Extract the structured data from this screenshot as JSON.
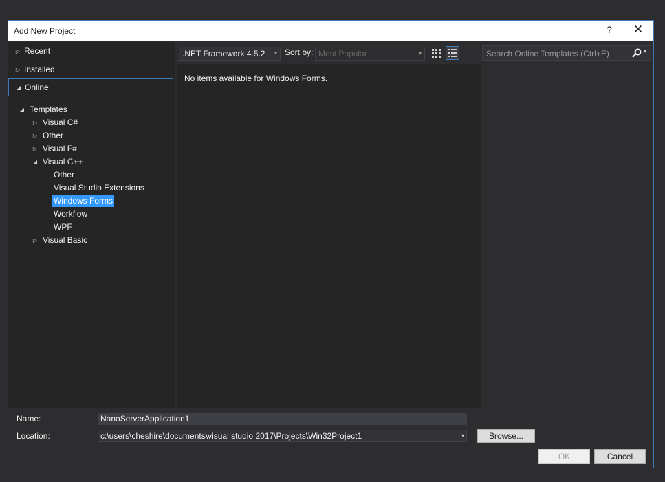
{
  "dialog": {
    "title": "Add New Project",
    "help_label": "?",
    "close_label": "✕"
  },
  "nav": {
    "sections": [
      {
        "label": "Recent",
        "arrow": "▷"
      },
      {
        "label": "Installed",
        "arrow": "▷"
      },
      {
        "label": "Online",
        "arrow": "◢"
      }
    ],
    "tree": [
      {
        "label": "Templates",
        "arrow": "◢"
      },
      {
        "label": "Visual C#",
        "arrow": "▷"
      },
      {
        "label": "Other",
        "arrow": "▷"
      },
      {
        "label": "Visual F#",
        "arrow": "▷"
      },
      {
        "label": "Visual C++",
        "arrow": "◢"
      },
      {
        "label": "Other",
        "arrow": ""
      },
      {
        "label": "Visual Studio Extensions",
        "arrow": ""
      },
      {
        "label": "Windows Forms",
        "arrow": ""
      },
      {
        "label": "Workflow",
        "arrow": ""
      },
      {
        "label": "WPF",
        "arrow": ""
      },
      {
        "label": "Visual Basic",
        "arrow": "▷"
      }
    ]
  },
  "toolbar": {
    "framework": ".NET Framework 4.5.2",
    "sort_label": "Sort by:",
    "sort_value": "Most Popular",
    "dropdown_glyph": "▾"
  },
  "search": {
    "placeholder": "Search Online Templates (Ctrl+E)",
    "dropdown_glyph": "▾"
  },
  "content": {
    "message": "No items available for Windows Forms."
  },
  "form": {
    "name_label": "Name:",
    "name_value": "NanoServerApplication1",
    "location_label": "Location:",
    "location_value": "c:\\users\\cheshire\\documents\\visual studio 2017\\Projects\\Win32Project1",
    "browse_label": "Browse...",
    "ok_label": "OK",
    "cancel_label": "Cancel"
  },
  "colors": {
    "accent": "#3e7bbd",
    "selection": "#3399ff",
    "panel": "#252526",
    "background": "#2d2d30"
  }
}
